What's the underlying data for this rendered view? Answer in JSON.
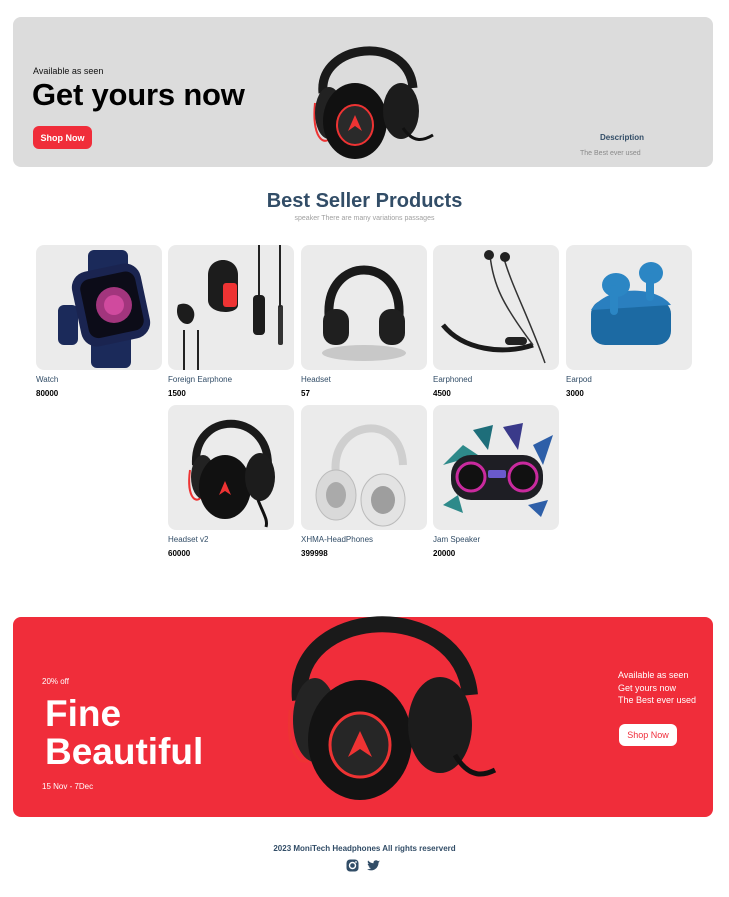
{
  "hero": {
    "small_text": "Available as seen",
    "large_text": "Get yours now",
    "button_label": "Shop Now",
    "desc_title": "Description",
    "desc_text": "The Best ever used"
  },
  "section": {
    "title": "Best Seller Products",
    "subtitle": "speaker There are many variations passages"
  },
  "products": [
    {
      "name": "Watch",
      "price": "80000",
      "icon": "smartwatch"
    },
    {
      "name": "Foreign Earphone",
      "price": "1500",
      "icon": "wired-earphone"
    },
    {
      "name": "Headset",
      "price": "57",
      "icon": "headphones"
    },
    {
      "name": "Earphoned",
      "price": "4500",
      "icon": "neckband-earphone"
    },
    {
      "name": "Earpod",
      "price": "3000",
      "icon": "earbuds"
    },
    {
      "name": "Headset v2",
      "price": "60000",
      "icon": "gaming-headset"
    },
    {
      "name": "XHMA-HeadPhones",
      "price": "399998",
      "icon": "white-headphones"
    },
    {
      "name": "Jam Speaker",
      "price": "20000",
      "icon": "speaker"
    }
  ],
  "banner": {
    "discount": "20% off",
    "large_text_1": "Fine",
    "large_text_2": "Beautiful",
    "date": "15 Nov - 7Dec",
    "right_line_1": "Available as seen",
    "right_line_2": "Get yours now",
    "right_line_3": "The Best ever used",
    "button_label": "Shop Now"
  },
  "footer": {
    "text": "2023 MoniTech Headphones All rights reserverd",
    "social_icons": [
      "instagram-icon",
      "twitter-icon"
    ]
  },
  "colors": {
    "accent": "#f02d3a",
    "heading": "#324d67",
    "hero_bg": "#dcdcdc",
    "card_bg": "#ebebeb"
  }
}
